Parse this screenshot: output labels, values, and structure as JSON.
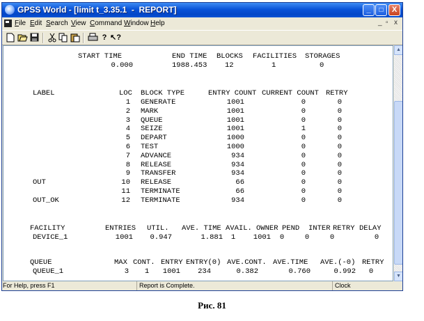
{
  "window": {
    "title": "GPSS World - [limit t_3.35.1  -  REPORT]"
  },
  "title_buttons": {
    "minimize": "_",
    "maximize": "□",
    "close": "X"
  },
  "menu": {
    "items": [
      "File",
      "Edit",
      "Search",
      "View",
      "Command",
      "Window",
      "Help"
    ],
    "mdi_min": "_",
    "mdi_restore": "▫",
    "mdi_close": "x"
  },
  "toolbar": {
    "icons": [
      "new-icon",
      "open-icon",
      "save-icon",
      "cut-icon",
      "copy-icon",
      "paste-icon",
      "print-icon",
      "help-icon",
      "context-help-icon"
    ]
  },
  "report": {
    "summary": {
      "headers": [
        "START TIME",
        "END TIME",
        "BLOCKS",
        "FACILITIES",
        "STORAGES"
      ],
      "values": [
        "0.000",
        "1988.453",
        "12",
        "1",
        "0"
      ]
    },
    "blocks": {
      "headers": [
        "LABEL",
        "LOC",
        "BLOCK TYPE",
        "ENTRY COUNT",
        "CURRENT COUNT",
        "RETRY"
      ],
      "rows": [
        [
          "",
          "1",
          "GENERATE",
          "1001",
          "0",
          "0"
        ],
        [
          "",
          "2",
          "MARK",
          "1001",
          "0",
          "0"
        ],
        [
          "",
          "3",
          "QUEUE",
          "1001",
          "0",
          "0"
        ],
        [
          "",
          "4",
          "SEIZE",
          "1001",
          "1",
          "0"
        ],
        [
          "",
          "5",
          "DEPART",
          "1000",
          "0",
          "0"
        ],
        [
          "",
          "6",
          "TEST",
          "1000",
          "0",
          "0"
        ],
        [
          "",
          "7",
          "ADVANCE",
          "934",
          "0",
          "0"
        ],
        [
          "",
          "8",
          "RELEASE",
          "934",
          "0",
          "0"
        ],
        [
          "",
          "9",
          "TRANSFER",
          "934",
          "0",
          "0"
        ],
        [
          "OUT",
          "10",
          "RELEASE",
          "66",
          "0",
          "0"
        ],
        [
          "",
          "11",
          "TERMINATE",
          "66",
          "0",
          "0"
        ],
        [
          "OUT_OK",
          "12",
          "TERMINATE",
          "934",
          "0",
          "0"
        ]
      ]
    },
    "facility": {
      "headers": [
        "FACILITY",
        "ENTRIES",
        "UTIL.",
        "AVE. TIME",
        "AVAIL.",
        "OWNER",
        "PEND",
        "INTER",
        "RETRY",
        "DELAY"
      ],
      "row": [
        "DEVICE_1",
        "1001",
        "0.947",
        "1.881",
        "1",
        "1001",
        "0",
        "0",
        "0",
        "0"
      ]
    },
    "queue": {
      "headers": [
        "QUEUE",
        "MAX",
        "CONT.",
        "ENTRY",
        "ENTRY(0)",
        "AVE.CONT.",
        "AVE.TIME",
        "AVE.(-0)",
        "RETRY"
      ],
      "row": [
        "QUEUE_1",
        "3",
        "1",
        "1001",
        "234",
        "0.382",
        "0.760",
        "0.992",
        "0"
      ]
    }
  },
  "status": {
    "help": "For Help, press F1",
    "message": "Report is Complete.",
    "clock": "Clock"
  },
  "caption": "Рис. 81"
}
